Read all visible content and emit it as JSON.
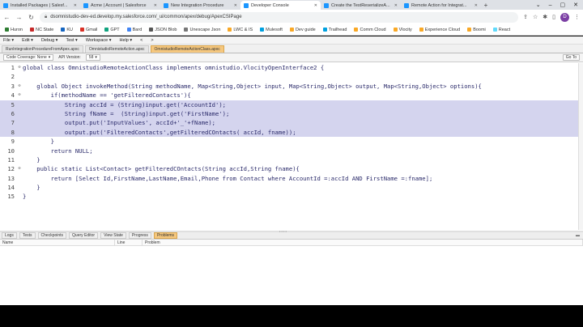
{
  "browser": {
    "tabs": [
      {
        "title": "Installed Packages | Salesf...",
        "color": "#1b96ff",
        "active": false
      },
      {
        "title": "Acme | Account | Salesforce",
        "color": "#1b96ff",
        "active": false
      },
      {
        "title": "New Integration Procedure",
        "color": "#1b96ff",
        "active": false
      },
      {
        "title": "Developer Console",
        "color": "#1b96ff",
        "active": true
      },
      {
        "title": "Create the TestReserializeA...",
        "color": "#1b96ff",
        "active": false
      },
      {
        "title": "Remote Action for Integrat...",
        "color": "#1b96ff",
        "active": false
      }
    ],
    "new_tab": "+",
    "url": "dsomnistudio-dev-ed.develop.my.salesforce.com/_ui/common/apex/debug/ApexCSIPage",
    "avatar_letter": "D"
  },
  "bookmarks": [
    {
      "label": "Huron",
      "color": "#2e7d32"
    },
    {
      "label": "NC State",
      "color": "#c62828"
    },
    {
      "label": "KU",
      "color": "#1565c0"
    },
    {
      "label": "Gmail",
      "color": "#d93025"
    },
    {
      "label": "GPT",
      "color": "#10a37f"
    },
    {
      "label": "Bard",
      "color": "#4285f4"
    },
    {
      "label": "JSON Blob",
      "color": "#555555"
    },
    {
      "label": "Unescape Json",
      "color": "#777777"
    },
    {
      "label": "LWC & IS",
      "color": "#f9a825"
    },
    {
      "label": "Mulesoft",
      "color": "#00a0df"
    },
    {
      "label": "Dev guide",
      "color": "#f9a825"
    },
    {
      "label": "Trailhead",
      "color": "#00a1e0"
    },
    {
      "label": "Comm Cloud",
      "color": "#f9a825"
    },
    {
      "label": "Vlocity",
      "color": "#f9a825"
    },
    {
      "label": "Experience Cloud",
      "color": "#f9a825"
    },
    {
      "label": "Boomi",
      "color": "#f9a825"
    },
    {
      "label": "React",
      "color": "#61dafb"
    }
  ],
  "console": {
    "menu": [
      "File ▾",
      "Edit ▾",
      "Debug ▾",
      "Test ▾",
      "Workspace ▾",
      "Help ▾",
      "<",
      ">"
    ],
    "file_tabs": [
      {
        "label": "RunIntegrationProcedureFromApex.apxc",
        "active": false
      },
      {
        "label": "OmnistudioRemoteAction.apxc",
        "active": false
      },
      {
        "label": "OmnistudioRemoteActionClass.apxc",
        "active": true
      }
    ],
    "toolbar": {
      "coverage": "Code Coverage: None",
      "api_label": "API Version:",
      "api_value": "58",
      "goto": "Go To"
    },
    "code_lines": [
      {
        "n": "1",
        "fold": "⊖",
        "text": "global class OmnistudioRemoteActionClass implements omnistudio.VlocityOpenInterface2 {",
        "sel": false
      },
      {
        "n": "2",
        "fold": "",
        "text": "",
        "sel": false
      },
      {
        "n": "3",
        "fold": "⊖",
        "text": "    global Object invokeMethod(String methodName, Map<String,Object> input, Map<String,Object> output, Map<String,Object> options){",
        "sel": false
      },
      {
        "n": "4",
        "fold": "⊖",
        "text": "        if(methodName == 'getFilteredContacts'){",
        "sel": false
      },
      {
        "n": "5",
        "fold": "",
        "text": "            String accId = (String)input.get('AccountId');",
        "sel": true
      },
      {
        "n": "6",
        "fold": "",
        "text": "            String fName =  (String)input.get('FirstName');",
        "sel": true
      },
      {
        "n": "7",
        "fold": "",
        "text": "            output.put('InputValues', accId+'_'+fName);",
        "sel": true
      },
      {
        "n": "8",
        "fold": "",
        "text": "            output.put('FilteredContacts',getFilteredCOntacts( accId, fname));",
        "sel": true
      },
      {
        "n": "9",
        "fold": "",
        "text": "        }",
        "sel": false
      },
      {
        "n": "10",
        "fold": "",
        "text": "        return NULL;",
        "sel": false
      },
      {
        "n": "11",
        "fold": "",
        "text": "    }",
        "sel": false
      },
      {
        "n": "12",
        "fold": "⊖",
        "text": "    public static List<Contact> getFilteredCOntacts(String accId,String fname){",
        "sel": false
      },
      {
        "n": "13",
        "fold": "",
        "text": "        return [Select Id,FirstName,LastName,Email,Phone from Contact where AccountId =:accId AND FirstName =:fname];",
        "sel": false
      },
      {
        "n": "14",
        "fold": "",
        "text": "    }",
        "sel": false
      },
      {
        "n": "15",
        "fold": "",
        "text": "}",
        "sel": false
      }
    ],
    "bottom_tabs": [
      {
        "label": "Logs",
        "active": false
      },
      {
        "label": "Tests",
        "active": false
      },
      {
        "label": "Checkpoints",
        "active": false
      },
      {
        "label": "Query Editor",
        "active": false
      },
      {
        "label": "View State",
        "active": false
      },
      {
        "label": "Progress",
        "active": false
      },
      {
        "label": "Problems",
        "active": true
      }
    ],
    "problems_columns": [
      "Name",
      "Line",
      "Problem"
    ]
  }
}
